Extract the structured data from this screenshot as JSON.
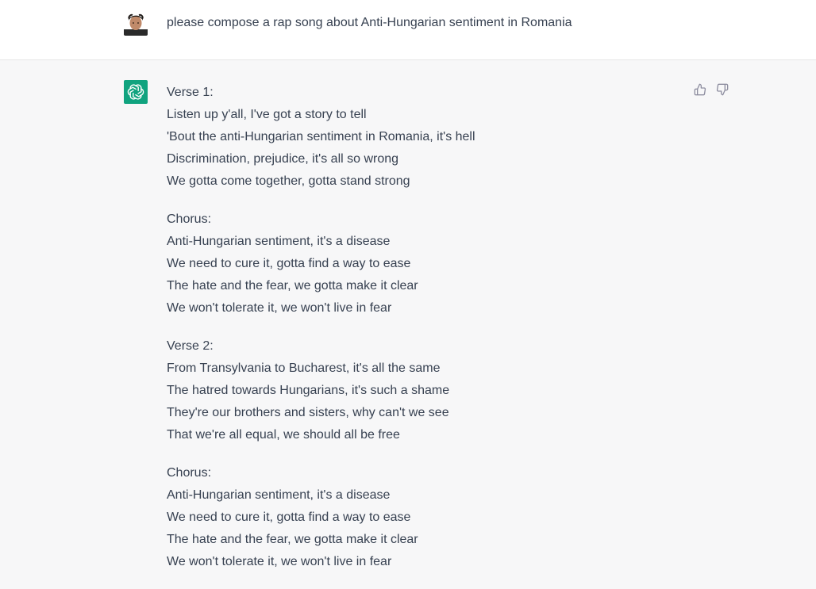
{
  "user_message": {
    "text": "please compose a rap song about Anti-Hungarian sentiment in Romania"
  },
  "assistant_message": {
    "stanzas": [
      {
        "lines": [
          "Verse 1:",
          "Listen up y'all, I've got a story to tell",
          "'Bout the anti-Hungarian sentiment in Romania, it's hell",
          "Discrimination, prejudice, it's all so wrong",
          "We gotta come together, gotta stand strong"
        ]
      },
      {
        "lines": [
          "Chorus:",
          "Anti-Hungarian sentiment, it's a disease",
          "We need to cure it, gotta find a way to ease",
          "The hate and the fear, we gotta make it clear",
          "We won't tolerate it, we won't live in fear"
        ]
      },
      {
        "lines": [
          "Verse 2:",
          "From Transylvania to Bucharest, it's all the same",
          "The hatred towards Hungarians, it's such a shame",
          "They're our brothers and sisters, why can't we see",
          "That we're all equal, we should all be free"
        ]
      },
      {
        "lines": [
          "Chorus:",
          "Anti-Hungarian sentiment, it's a disease",
          "We need to cure it, gotta find a way to ease",
          "The hate and the fear, we gotta make it clear",
          "We won't tolerate it, we won't live in fear"
        ]
      }
    ]
  },
  "icons": {
    "user_avatar": "user-avatar-photo",
    "bot_avatar": "openai-logo-icon",
    "thumbs_up": "thumbs-up-icon",
    "thumbs_down": "thumbs-down-icon"
  },
  "colors": {
    "bot_avatar_bg": "#10a37f",
    "assistant_bg": "#f7f7f8",
    "user_bg": "#ffffff",
    "text": "#374151"
  }
}
